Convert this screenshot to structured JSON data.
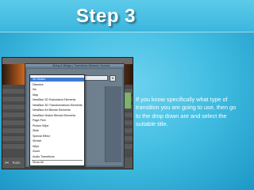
{
  "slide": {
    "title": "Step 3",
    "body": "If you know specifically what type of transition you are going to use, then go to the drop down are and select the suitable title."
  },
  "dialog": {
    "header": "String & Bridge  |  Transitions Between Scenes",
    "selected_value": "3D Motion",
    "options": [
      "3D Motion",
      "Dissolve",
      "Iris",
      "Map",
      "NewBlue 3D Explosions Elements",
      "NewBlue 3D Transformations Elements",
      "NewBlue Art Blends Elements",
      "NewBlue Motion Blends Elements",
      "Page Peel",
      "Picture Wipe",
      "Slide",
      "Special Effect",
      "Stretch",
      "Wipe",
      "Zoom",
      "Audio Transitions",
      "Show All"
    ],
    "highlighted_option": "3D Motion"
  },
  "timeline": {
    "bottom_left_label": "Tools",
    "bottom_right_label": "Music"
  },
  "colors": {
    "background": "#44bfe3",
    "title_text": "#ffffff",
    "highlight": "#3d7bd1"
  }
}
